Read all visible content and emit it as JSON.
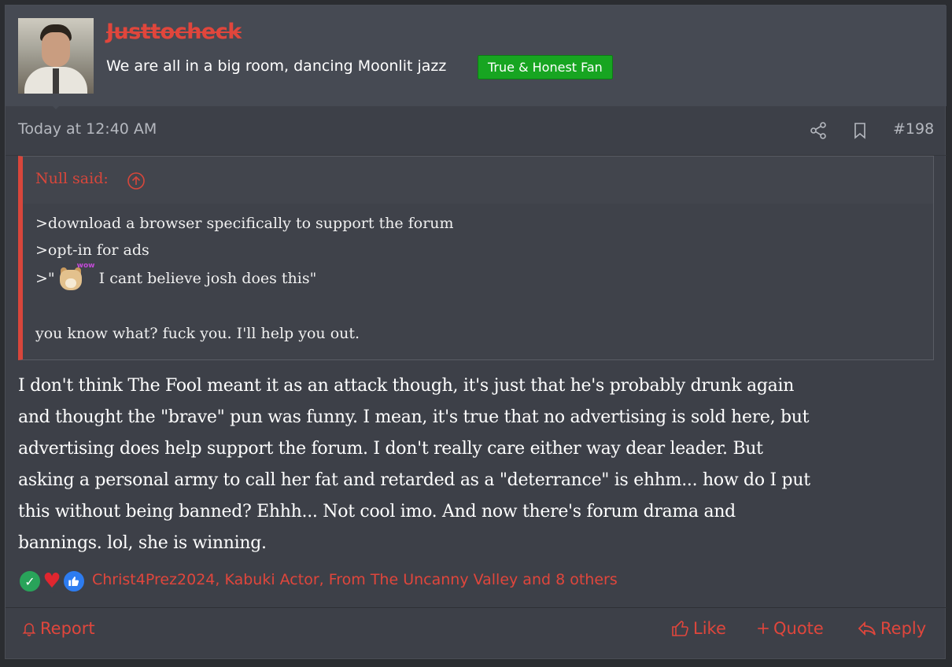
{
  "user": {
    "name": "Justtocheck",
    "title": "We are all in a big room, dancing Moonlit jazz",
    "banner": "True & Honest Fan"
  },
  "meta": {
    "timestamp": "Today at 12:40 AM",
    "post_number": "#198",
    "icons": [
      "share-icon",
      "bookmark-icon"
    ]
  },
  "quote": {
    "author": "Null said:",
    "lines": [
      ">download a browser specifically to support the forum",
      ">opt-in for ads",
      ">\"",
      "I cant believe josh does this\"",
      "you know what? fuck you. I'll help you out."
    ],
    "emoji_label": "wow"
  },
  "body": {
    "lines": [
      "I don't think The Fool meant it as an attack though, it's just that he's probably drunk again",
      "and thought the \"brave\" pun was funny. I mean, it's true that no advertising is sold here, but",
      "advertising does help support the forum. I don't really care either way dear leader. But",
      "asking a personal army to call her fat and retarded as a \"deterrance\" is ehhm... how do I put",
      "this without being banned? Ehhh... Not cool imo. And now there's forum drama and",
      "bannings. lol, she is winning."
    ]
  },
  "reactions": {
    "names": "Christ4Prez2024, Kabuki Actor, From The Uncanny Valley and 8 others",
    "icons": [
      "check-icon",
      "heart-icon",
      "thumbs-up-icon"
    ]
  },
  "actions": {
    "report": "Report",
    "like": "Like",
    "quote": "Quote",
    "reply": "Reply"
  },
  "colors": {
    "accent": "#e0463c",
    "banner_bg": "#17a521",
    "page_bg": "#3d4048",
    "header_bg": "#464a53"
  }
}
